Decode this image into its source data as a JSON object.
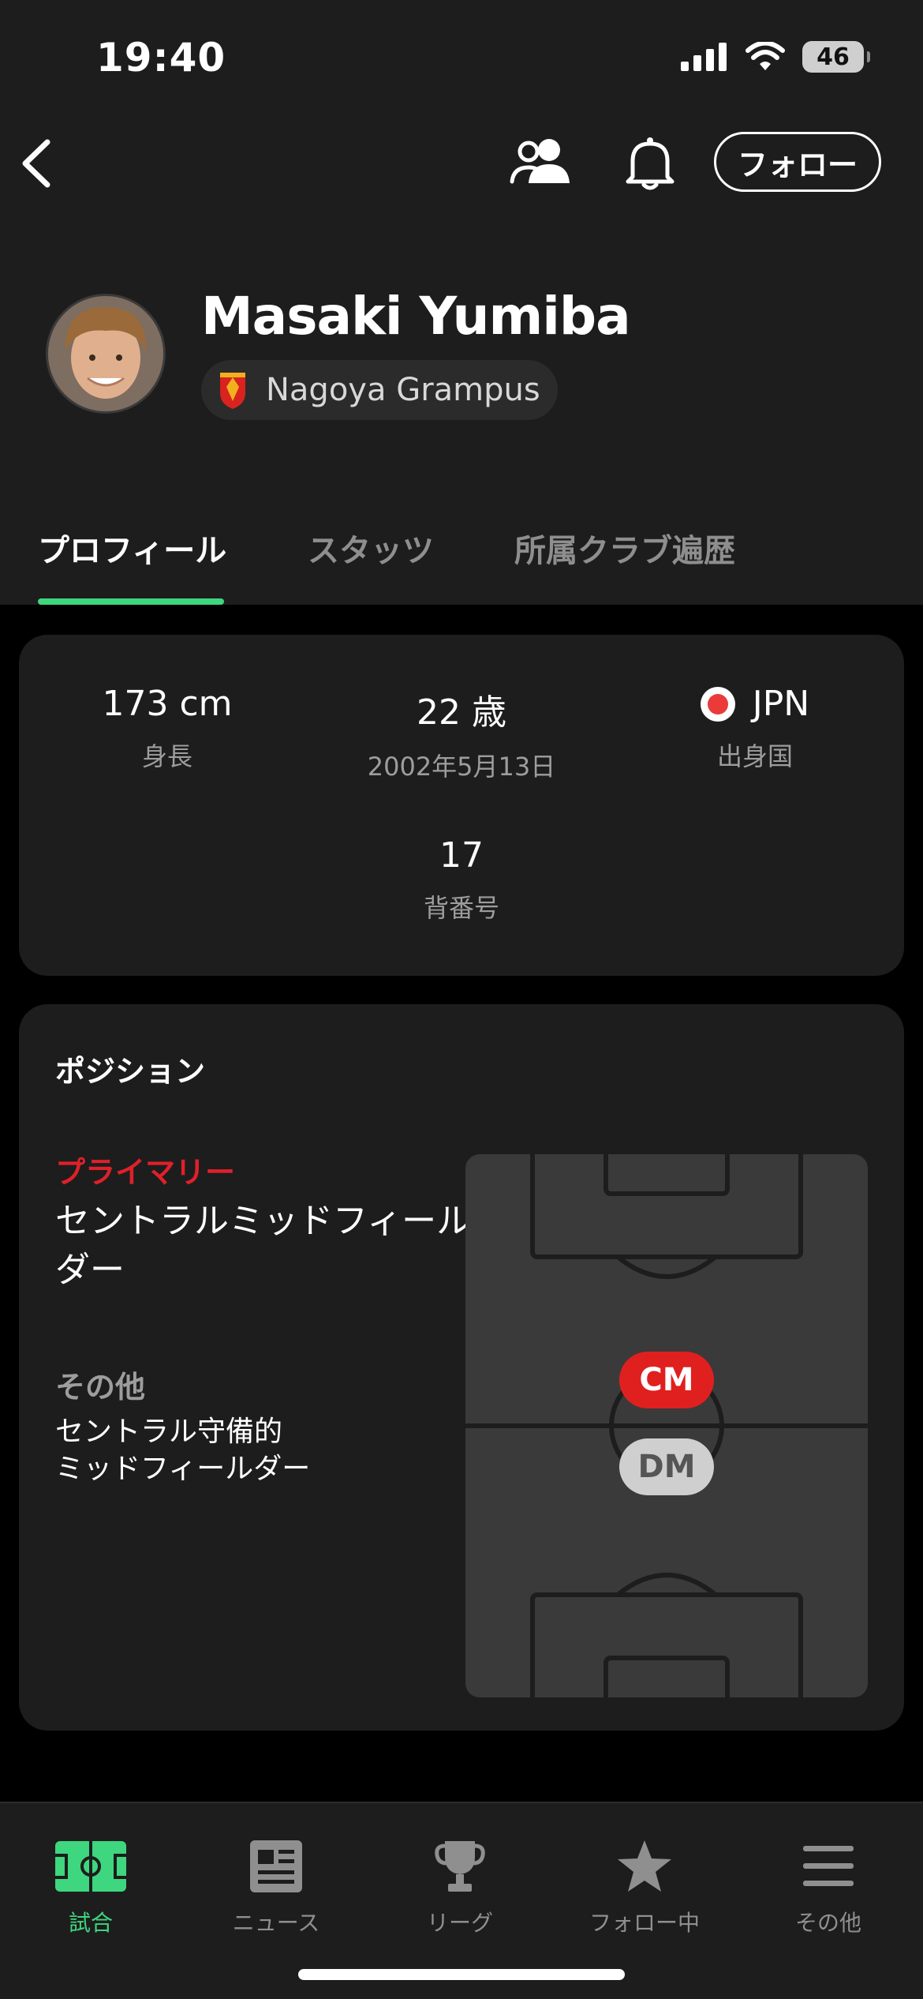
{
  "status_bar": {
    "time": "19:40",
    "battery": "46"
  },
  "header": {
    "follow_label": "フォロー"
  },
  "player": {
    "name": "Masaki Yumiba",
    "club": "Nagoya Grampus"
  },
  "tabs": [
    {
      "label": "プロフィール",
      "active": true
    },
    {
      "label": "スタッツ",
      "active": false
    },
    {
      "label": "所属クラブ遍歴",
      "active": false
    }
  ],
  "info": {
    "height": {
      "value": "173 cm",
      "label": "身長"
    },
    "age": {
      "value": "22 歳",
      "label": "2002年5月13日"
    },
    "country": {
      "value": "JPN",
      "label": "出身国"
    },
    "number": {
      "value": "17",
      "label": "背番号"
    }
  },
  "position": {
    "title": "ポジション",
    "primary_label": "プライマリー",
    "primary_value": "セントラルミッドフィールダー",
    "other_label": "その他",
    "other_value_line1": "セントラル守備的",
    "other_value_line2": "ミッドフィールダー",
    "badges": {
      "primary": "CM",
      "other": "DM"
    }
  },
  "bottom_nav": [
    {
      "label": "試合",
      "icon": "pitch-icon",
      "active": true
    },
    {
      "label": "ニュース",
      "icon": "newspaper-icon",
      "active": false
    },
    {
      "label": "リーグ",
      "icon": "trophy-icon",
      "active": false
    },
    {
      "label": "フォロー中",
      "icon": "star-icon",
      "active": false
    },
    {
      "label": "その他",
      "icon": "menu-icon",
      "active": false
    }
  ],
  "colors": {
    "accent_green": "#3ed67e",
    "primary_red": "#e0202a",
    "background": "#000000",
    "surface": "#1d1d1d"
  }
}
